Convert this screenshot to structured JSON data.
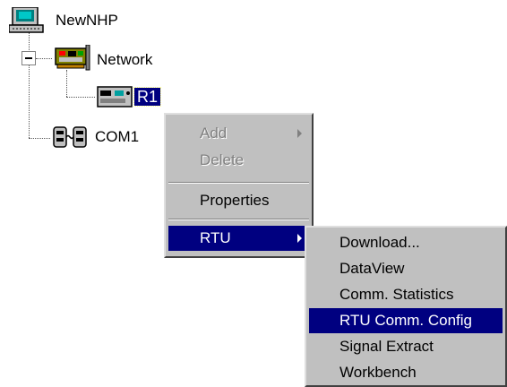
{
  "tree": {
    "root": {
      "label": "NewNHP",
      "icon": "workstation-icon"
    },
    "network": {
      "label": "Network",
      "icon": "network-card-icon",
      "expander": "collapse-minus"
    },
    "rtu": {
      "label": "R1",
      "icon": "rtu-device-icon",
      "selected": true
    },
    "port": {
      "label": "COM1",
      "icon": "serial-port-icon"
    }
  },
  "context_menu": {
    "add_label": "Add",
    "delete_label": "Delete",
    "properties_label": "Properties",
    "rtu_label": "RTU"
  },
  "rtu_submenu": {
    "items": [
      {
        "label": "Download..."
      },
      {
        "label": "DataView"
      },
      {
        "label": "Comm. Statistics"
      },
      {
        "label": "RTU Comm. Config",
        "highlighted": true
      },
      {
        "label": "Signal Extract"
      },
      {
        "label": "Workbench"
      }
    ]
  },
  "colors": {
    "highlight": "#000080",
    "menu_face": "#c0c0c0",
    "disabled_text": "#808080"
  }
}
